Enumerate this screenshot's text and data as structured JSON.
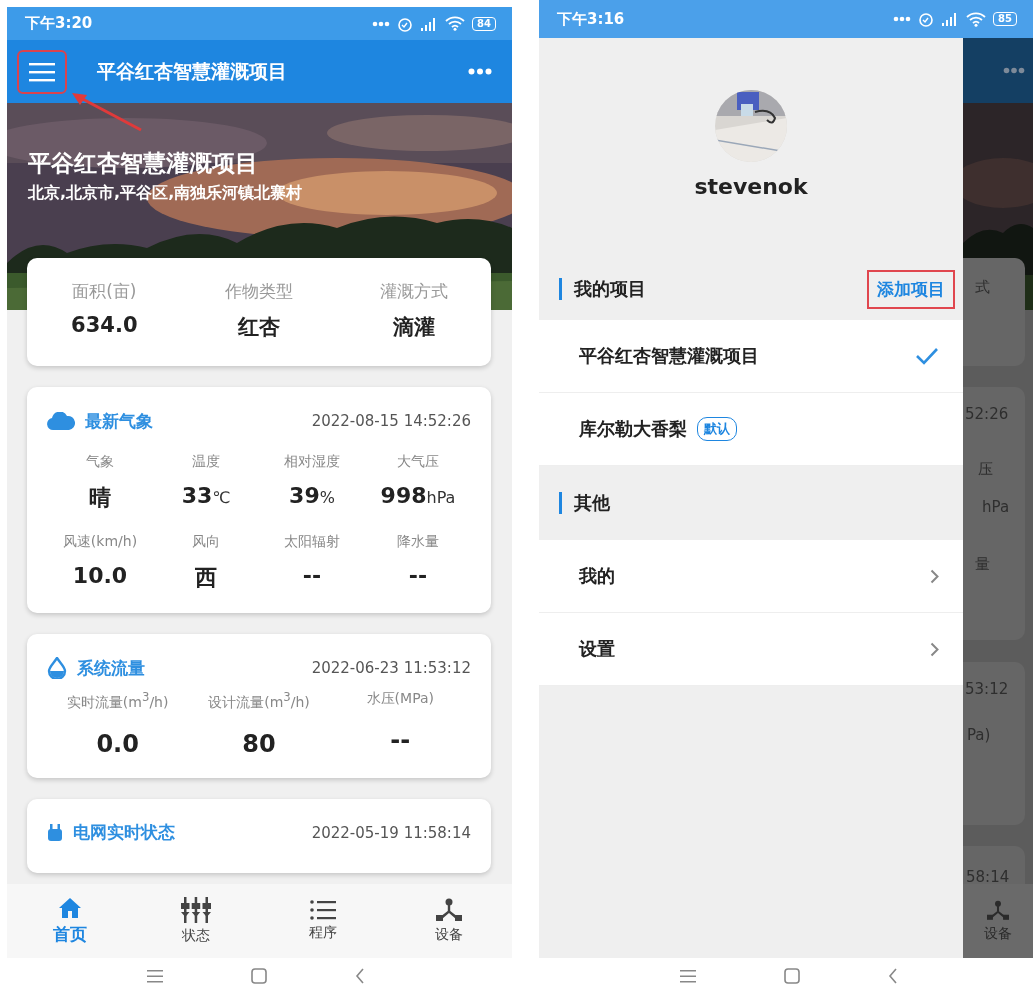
{
  "home_screen": {
    "status_bar": {
      "time": "下午3:20",
      "battery": "84"
    },
    "app_bar": {
      "title": "平谷红杏智慧灌溉项目"
    },
    "hero": {
      "title": "平谷红杏智慧灌溉项目",
      "address": "北京,北京市,平谷区,南独乐河镇北寨村"
    },
    "summary": [
      {
        "label": "面积(亩)",
        "value": "634.0"
      },
      {
        "label": "作物类型",
        "value": "红杏"
      },
      {
        "label": "灌溉方式",
        "value": "滴灌"
      }
    ],
    "cards": [
      {
        "title": "最新气象",
        "time": "2022-08-15 14:52:26",
        "items": [
          {
            "label": "气象",
            "value": "晴"
          },
          {
            "label": "温度",
            "value": "33",
            "unit": "℃"
          },
          {
            "label": "相对湿度",
            "value": "39",
            "unit": "%"
          },
          {
            "label": "大气压",
            "value": "998",
            "unit": "hPa"
          },
          {
            "label": "风速(km/h)",
            "value": "10.0"
          },
          {
            "label": "风向",
            "value": "西"
          },
          {
            "label": "太阳辐射",
            "value": "--"
          },
          {
            "label": "降水量",
            "value": "--"
          }
        ]
      },
      {
        "title": "系统流量",
        "time": "2022-06-23 11:53:12",
        "items": [
          {
            "label": "实时流量(m$^{3}$/h)",
            "value": "0.0"
          },
          {
            "label": "设计流量(m$^{3}$/h)",
            "value": "80"
          },
          {
            "label": "水压(MPa)",
            "value": "--"
          }
        ]
      },
      {
        "title": "电网实时状态",
        "time": "2022-05-19 11:58:14"
      }
    ],
    "tabs": [
      {
        "label": "首页",
        "selected": true
      },
      {
        "label": "状态",
        "selected": false
      },
      {
        "label": "程序",
        "selected": false
      },
      {
        "label": "设备",
        "selected": false
      }
    ]
  },
  "drawer_screen": {
    "status_bar": {
      "time": "下午3:16",
      "battery": "85"
    },
    "profile": {
      "username": "stevenok"
    },
    "sections": [
      {
        "title": "我的项目",
        "action": "添加项目",
        "items": [
          {
            "kind": "project",
            "label": "平谷红杏智慧灌溉项目",
            "selected": true
          },
          {
            "kind": "project",
            "label": "库尔勒大香梨",
            "badge": "默认",
            "selected": false
          }
        ]
      },
      {
        "title": "其他",
        "items": [
          {
            "kind": "link",
            "label": "我的"
          },
          {
            "kind": "link",
            "label": "设置"
          }
        ]
      }
    ],
    "backdrop": {
      "fragments": [
        "式",
        "52:26",
        "压",
        "hPa",
        "量",
        "53:12",
        "Pa)",
        "58:14"
      ],
      "tab_label": "设备"
    }
  }
}
